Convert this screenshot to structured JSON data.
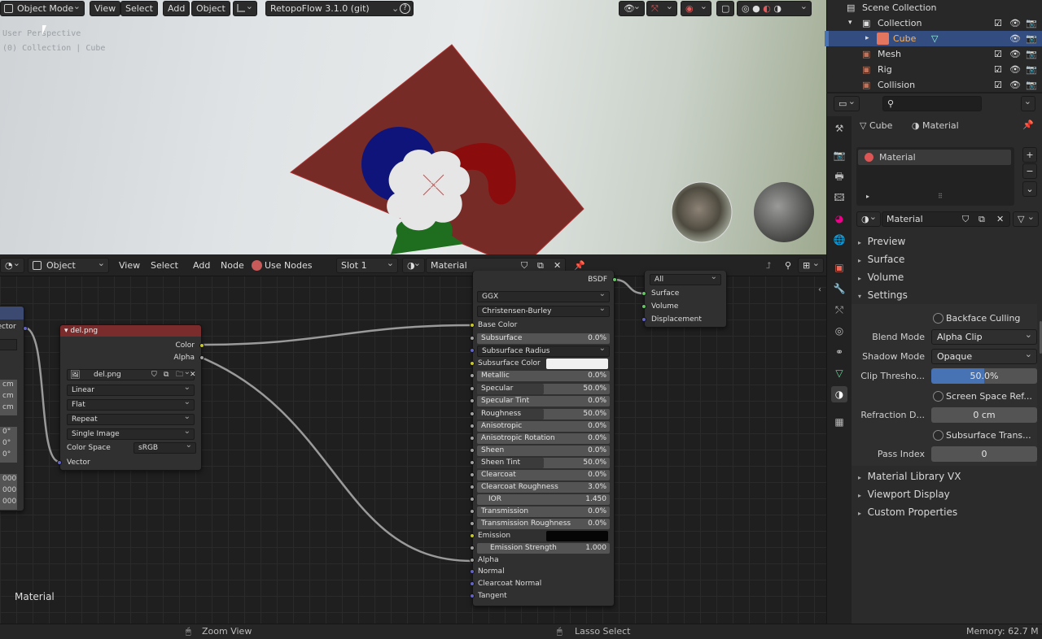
{
  "viewport": {
    "mode": "Object Mode",
    "menu": [
      "View",
      "Select",
      "Add",
      "Object"
    ],
    "addon": "RetopoFlow 3.1.0 (git)",
    "overlay_line1": "User Perspective",
    "overlay_line2": "(0) Collection | Cube",
    "plane_color": "#772b26"
  },
  "node_editor": {
    "type": "Object",
    "menu": [
      "View",
      "Select",
      "Add",
      "Node"
    ],
    "use_nodes": "Use Nodes",
    "slot": "Slot 1",
    "material": "Material",
    "frame_label": "Material",
    "image_node": {
      "title": "del.png",
      "out_color": "Color",
      "out_alpha": "Alpha",
      "image": "del.png",
      "interpolation": "Linear",
      "projection": "Flat",
      "extension": "Repeat",
      "source": "Single Image",
      "colorspace_label": "Color Space",
      "colorspace": "sRGB",
      "in_vector": "Vector"
    },
    "left_node": {
      "out_vector": "Vector",
      "rows": [
        "cm",
        "cm",
        "cm",
        "0°",
        "0°",
        "0°",
        "000",
        "000",
        "000"
      ]
    },
    "bsdf": {
      "out": "BSDF",
      "distribution": "GGX",
      "subsurface_method": "Christensen-Burley",
      "base_color": "Base Color",
      "subsurface": {
        "label": "Subsurface",
        "value": "0.0%"
      },
      "subsurface_radius": "Subsurface Radius",
      "subsurface_color": "Subsurface Color",
      "metallic": {
        "label": "Metallic",
        "value": "0.0%"
      },
      "specular": {
        "label": "Specular",
        "value": "50.0%"
      },
      "specular_tint": {
        "label": "Specular Tint",
        "value": "0.0%"
      },
      "roughness": {
        "label": "Roughness",
        "value": "50.0%"
      },
      "anisotropic": {
        "label": "Anisotropic",
        "value": "0.0%"
      },
      "anisotropic_rotation": {
        "label": "Anisotropic Rotation",
        "value": "0.0%"
      },
      "sheen": {
        "label": "Sheen",
        "value": "0.0%"
      },
      "sheen_tint": {
        "label": "Sheen Tint",
        "value": "50.0%"
      },
      "clearcoat": {
        "label": "Clearcoat",
        "value": "0.0%"
      },
      "clearcoat_roughness": {
        "label": "Clearcoat Roughness",
        "value": "3.0%"
      },
      "ior": {
        "label": "IOR",
        "value": "1.450"
      },
      "transmission": {
        "label": "Transmission",
        "value": "0.0%"
      },
      "transmission_roughness": {
        "label": "Transmission Roughness",
        "value": "0.0%"
      },
      "emission": "Emission",
      "emission_strength": {
        "label": "Emission Strength",
        "value": "1.000"
      },
      "alpha": "Alpha",
      "normal": "Normal",
      "clearcoat_normal": "Clearcoat Normal",
      "tangent": "Tangent"
    },
    "output_node": {
      "target": "All",
      "surface": "Surface",
      "volume": "Volume",
      "displacement": "Displacement"
    }
  },
  "outliner": {
    "items": [
      {
        "label": "Scene Collection"
      },
      {
        "label": "Collection"
      },
      {
        "label": "Cube"
      },
      {
        "label": "Mesh"
      },
      {
        "label": "Rig"
      },
      {
        "label": "Collision"
      }
    ]
  },
  "properties": {
    "breadcrumb_object": "Cube",
    "breadcrumb_material": "Material",
    "slot_name": "Material",
    "material_name": "Material",
    "sections": {
      "preview": "Preview",
      "surface": "Surface",
      "volume": "Volume",
      "settings": "Settings",
      "material_library": "Material Library VX",
      "viewport_display": "Viewport Display",
      "custom_properties": "Custom Properties"
    },
    "backface_culling": "Backface Culling",
    "blend_mode": {
      "label": "Blend Mode",
      "value": "Alpha Clip"
    },
    "shadow_mode": {
      "label": "Shadow Mode",
      "value": "Opaque"
    },
    "clip_threshold": {
      "label": "Clip Thresho...",
      "value": "50.0%"
    },
    "screen_space_refraction": "Screen Space Ref...",
    "refraction_depth": {
      "label": "Refraction D...",
      "value": "0 cm"
    },
    "subsurface_translucency": "Subsurface Trans...",
    "pass_index": {
      "label": "Pass Index",
      "value": "0"
    }
  },
  "status_bar": {
    "zoom": "Zoom View",
    "lasso": "Lasso Select",
    "memory": "Memory: 62.7 M"
  }
}
